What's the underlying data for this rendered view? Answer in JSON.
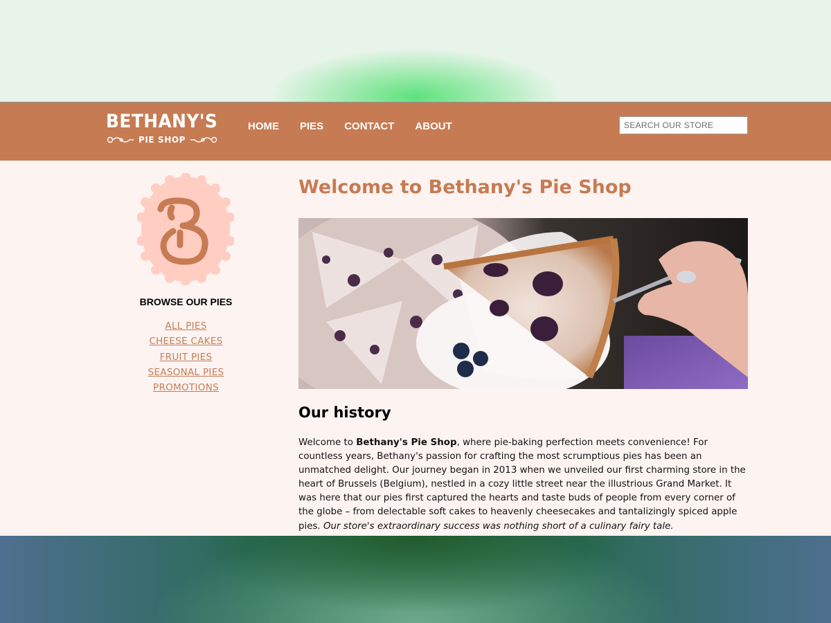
{
  "brand": {
    "name": "BETHANY'S",
    "tagline": "PIE SHOP",
    "badge_letter": "B",
    "colors": {
      "primary": "#c67b53",
      "badge": "#ffcdc2",
      "page_background": "#fdf4f2"
    }
  },
  "nav": {
    "items": [
      {
        "label": "HOME"
      },
      {
        "label": "PIES"
      },
      {
        "label": "CONTACT"
      },
      {
        "label": "ABOUT"
      }
    ],
    "search": {
      "placeholder": "SEARCH OUR STORE",
      "value": ""
    }
  },
  "sidebar": {
    "title": "BROWSE OUR PIES",
    "categories": [
      {
        "label": "ALL PIES"
      },
      {
        "label": "CHEESE CAKES"
      },
      {
        "label": "FRUIT PIES"
      },
      {
        "label": "SEASONAL PIES"
      },
      {
        "label": "PROMOTIONS"
      }
    ]
  },
  "main": {
    "title": "Welcome to Bethany's Pie Shop",
    "hero_image": "blueberry-pie-slice-photo",
    "history": {
      "heading": "Our history",
      "intro": "Welcome to ",
      "shop_name": "Bethany's Pie Shop",
      "body": ", where pie-baking perfection meets convenience! For countless years, Bethany's passion for crafting the most scrumptious pies has been an unmatched delight. Our journey began in 2013 when we unveiled our first charming store in the heart of Brussels (Belgium), nestled in a cozy little street near the illustrious Grand Market. It was here that our pies first captured the hearts and taste buds of people from every corner of the globe – from delectable soft cakes to heavenly cheesecakes and tantalizingly spiced apple pies. ",
      "closing": "Our store's extraordinary success was nothing short of a culinary fairy tale."
    }
  }
}
